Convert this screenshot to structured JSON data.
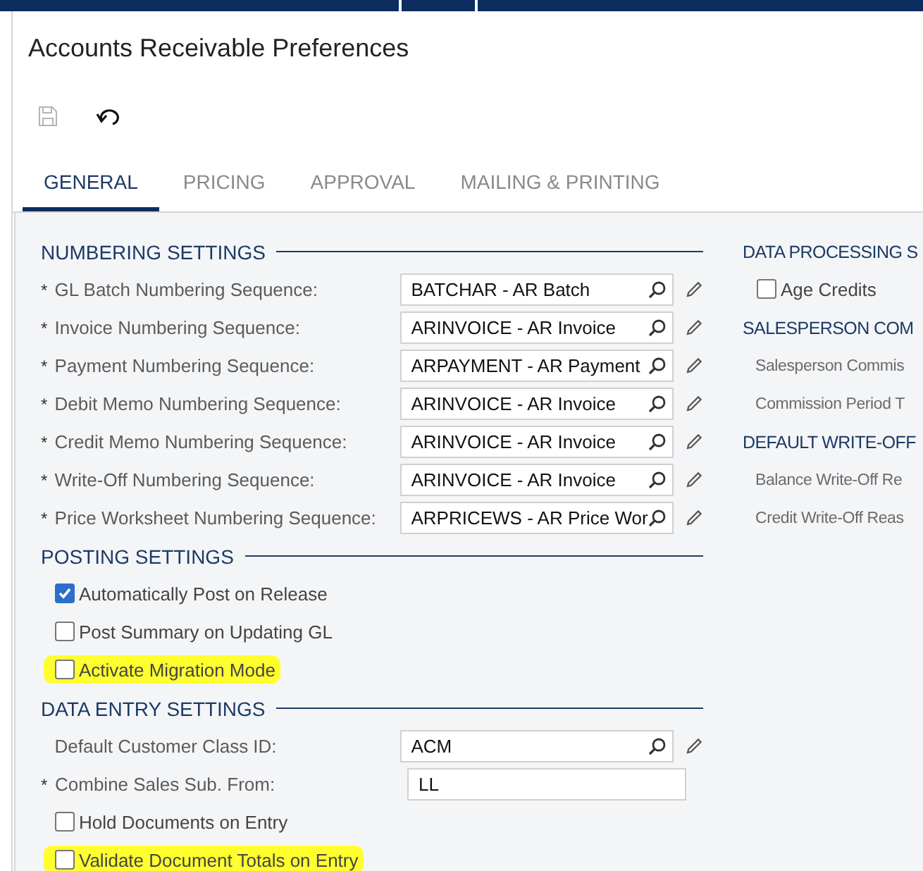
{
  "title": "Accounts Receivable Preferences",
  "toolbar": [
    {
      "kind": "save",
      "disabled": true
    },
    {
      "kind": "undo",
      "disabled": false
    }
  ],
  "tabs": [
    {
      "label": "GENERAL",
      "selected": true
    },
    {
      "label": "PRICING",
      "selected": false
    },
    {
      "label": "APPROVAL",
      "selected": false
    },
    {
      "label": "MAILING & PRINTING",
      "selected": false
    }
  ],
  "left_sections": [
    {
      "title": "NUMBERING SETTINGS",
      "rows": [
        {
          "kind": "lookup",
          "required": "*",
          "label": "GL Batch Numbering Sequence:",
          "value": "BATCHAR - AR Batch"
        },
        {
          "kind": "lookup",
          "required": "*",
          "label": "Invoice Numbering Sequence:",
          "value": "ARINVOICE - AR Invoice"
        },
        {
          "kind": "lookup",
          "required": "*",
          "label": "Payment Numbering Sequence:",
          "value": "ARPAYMENT - AR Payment"
        },
        {
          "kind": "lookup",
          "required": "*",
          "label": "Debit Memo Numbering Sequence:",
          "value": "ARINVOICE - AR Invoice"
        },
        {
          "kind": "lookup",
          "required": "*",
          "label": "Credit Memo Numbering Sequence:",
          "value": "ARINVOICE - AR Invoice"
        },
        {
          "kind": "lookup",
          "required": "*",
          "label": "Write-Off Numbering Sequence:",
          "value": "ARINVOICE - AR Invoice"
        },
        {
          "kind": "lookup",
          "required": "*",
          "label": "Price Worksheet Numbering Sequence:",
          "value": "ARPRICEWS - AR Price Wor"
        }
      ]
    },
    {
      "title": "POSTING SETTINGS",
      "rows": [
        {
          "kind": "checkbox",
          "label": "Automatically Post on Release",
          "checked": true,
          "highlighted": false
        },
        {
          "kind": "checkbox",
          "label": "Post Summary on Updating GL",
          "checked": false,
          "highlighted": false
        },
        {
          "kind": "checkbox",
          "label": "Activate Migration Mode",
          "checked": false,
          "highlighted": true
        }
      ]
    },
    {
      "title": "DATA ENTRY SETTINGS",
      "rows": [
        {
          "kind": "lookup",
          "label": "Default Customer Class ID:",
          "value": "ACM"
        },
        {
          "kind": "text",
          "required": "*",
          "label": "Combine Sales Sub. From:",
          "value": "LL"
        },
        {
          "kind": "checkbox",
          "label": "Hold Documents on Entry",
          "checked": false,
          "highlighted": false
        },
        {
          "kind": "checkbox",
          "label": "Validate Document Totals on Entry",
          "checked": false,
          "highlighted": true
        }
      ]
    }
  ],
  "right_sections": [
    {
      "title": "DATA PROCESSING S",
      "rows": [
        {
          "kind": "checkbox",
          "label": "Age Credits",
          "checked": false,
          "highlighted": false
        }
      ]
    },
    {
      "title": "SALESPERSON COM",
      "rows": [
        {
          "kind": "label",
          "label": "Salesperson Commis"
        },
        {
          "kind": "label",
          "label": "Commission Period T"
        }
      ]
    },
    {
      "title": "DEFAULT WRITE-OFF",
      "rows": [
        {
          "kind": "label",
          "label": "Balance Write-Off Re"
        },
        {
          "kind": "label",
          "label": "Credit Write-Off Reas"
        }
      ]
    }
  ]
}
